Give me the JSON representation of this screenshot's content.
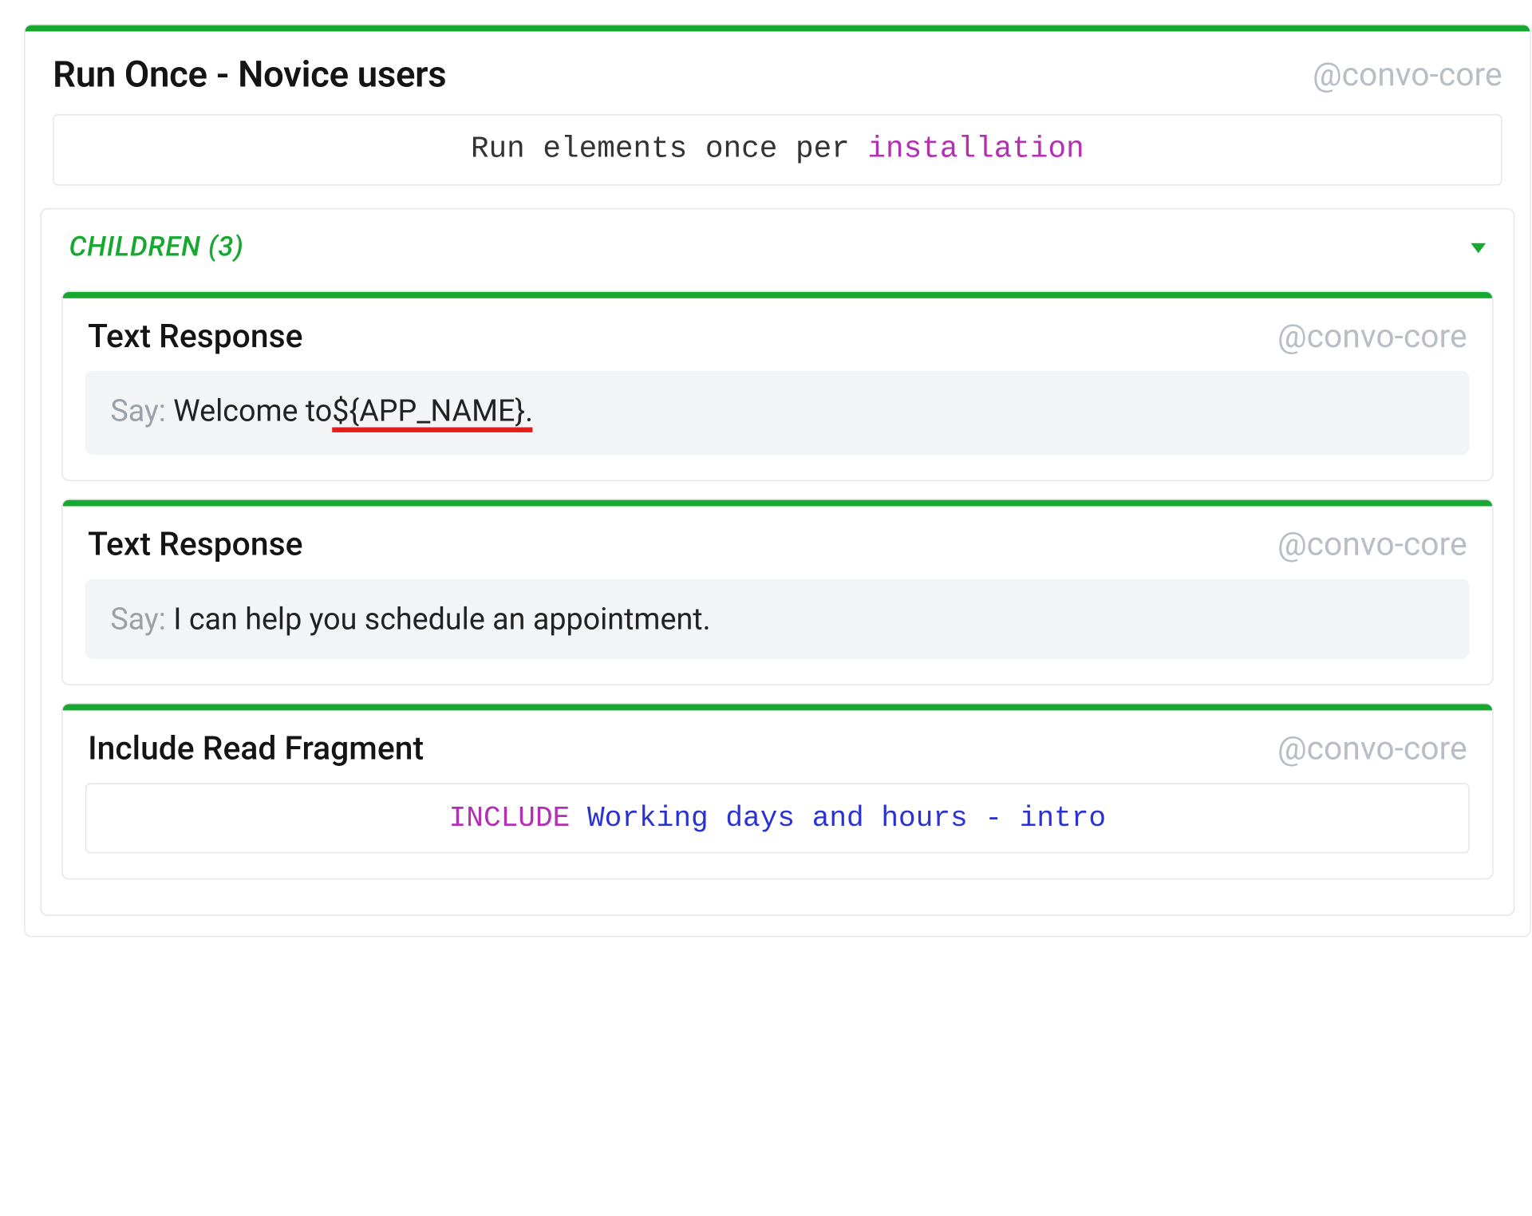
{
  "main": {
    "title": "Run Once - Novice users",
    "tag": "@convo-core",
    "param": {
      "prefix": "Run elements once per ",
      "value": "installation"
    },
    "children_label": "CHILDREN (3)",
    "children": [
      {
        "type": "Text Response",
        "tag": "@convo-core",
        "say_label": "Say: ",
        "say_prefix": "Welcome to",
        "say_underlined": " ${APP_NAME}.",
        "has_red_underline": true
      },
      {
        "type": "Text Response",
        "tag": "@convo-core",
        "say_label": "Say: ",
        "say_text": "I can help you schedule an appointment."
      },
      {
        "type": "Include Read Fragment",
        "tag": "@convo-core",
        "include_keyword": "INCLUDE",
        "include_name": " Working days and hours - intro"
      }
    ]
  }
}
